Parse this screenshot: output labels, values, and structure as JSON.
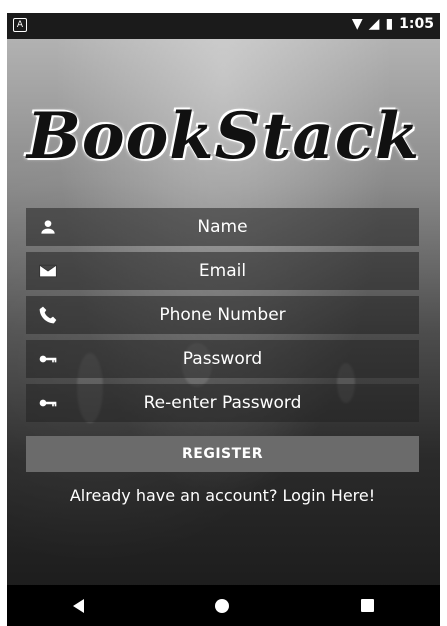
{
  "status_bar": {
    "time": "1:05",
    "notification_icon": "android-icon"
  },
  "app": {
    "logo": "BookStack"
  },
  "form": {
    "fields": [
      {
        "label": "Name",
        "icon": "person-icon"
      },
      {
        "label": "Email",
        "icon": "email-icon"
      },
      {
        "label": "Phone Number",
        "icon": "phone-icon"
      },
      {
        "label": "Password",
        "icon": "key-icon"
      },
      {
        "label": "Re-enter Password",
        "icon": "key-icon"
      }
    ],
    "register_label": "REGISTER",
    "login_link": "Already have an account? Login Here!"
  },
  "colors": {
    "field_bg": "#232323",
    "button_bg": "#6b6b6b",
    "text": "#ffffff"
  }
}
